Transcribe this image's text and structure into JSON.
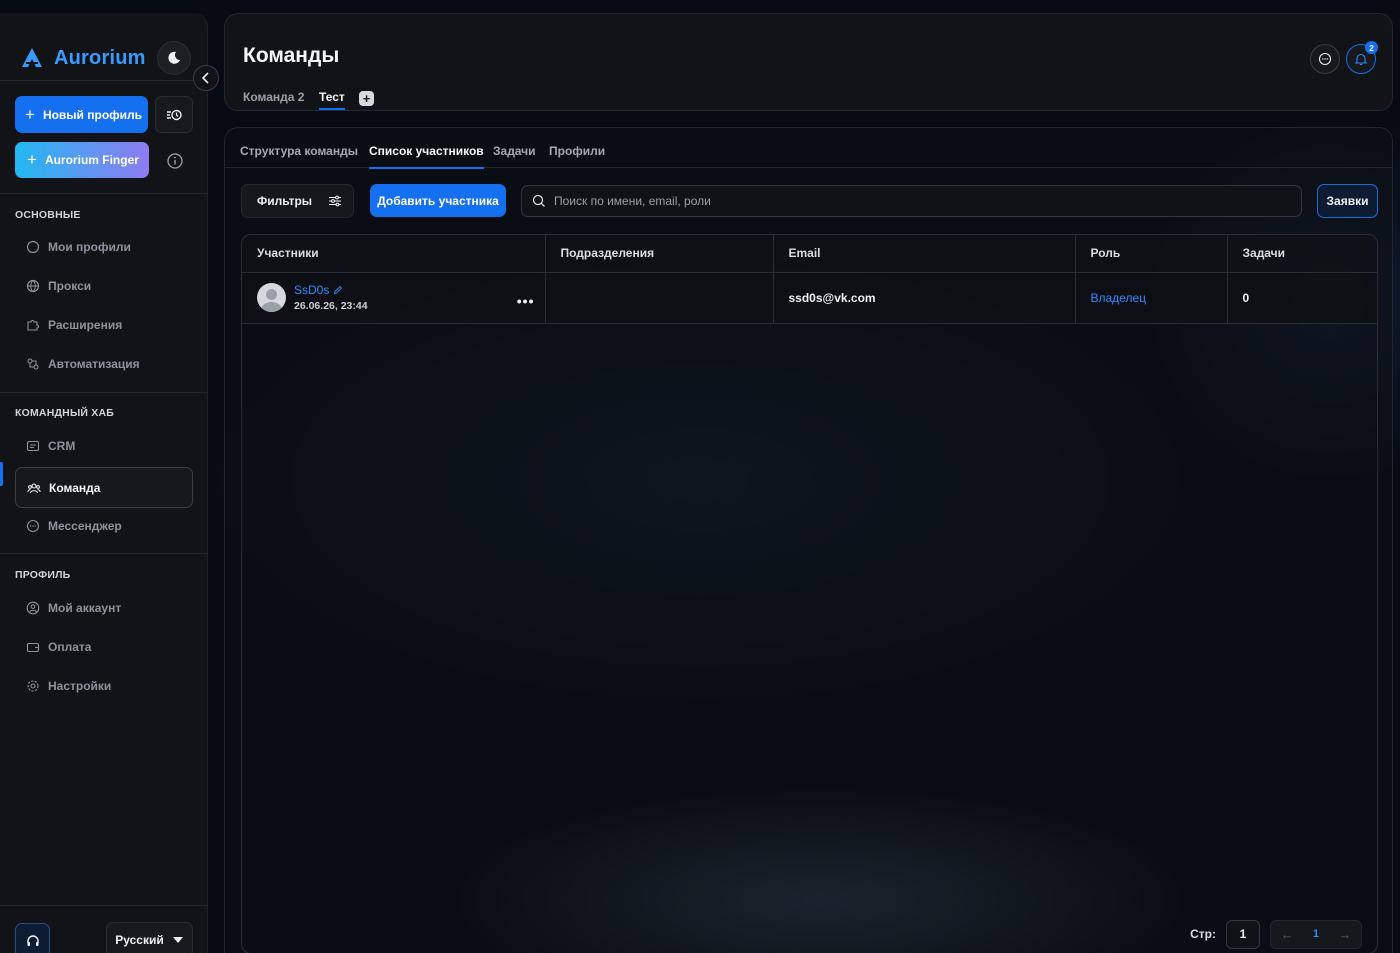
{
  "brand": {
    "name": "Aurorium"
  },
  "sidebar": {
    "new_profile_label": "Новый профиль",
    "finger_label": "Aurorium Finger",
    "sections": {
      "main": "ОСНОВНЫЕ",
      "team_hub": "КОМАНДНЫЙ ХАБ",
      "profile": "ПРОФИЛЬ"
    },
    "items": [
      {
        "label": "Мои профили",
        "icon": "browser-icon"
      },
      {
        "label": "Прокси",
        "icon": "globe-icon"
      },
      {
        "label": "Расширения",
        "icon": "puzzle-icon"
      },
      {
        "label": "Автоматизация",
        "icon": "automation-icon"
      },
      {
        "label": "CRM",
        "icon": "crm-icon"
      },
      {
        "label": "Команда",
        "icon": "team-icon",
        "active": true
      },
      {
        "label": "Мессенджер",
        "icon": "chat-icon"
      },
      {
        "label": "Мой аккаунт",
        "icon": "user-icon"
      },
      {
        "label": "Оплата",
        "icon": "wallet-icon"
      },
      {
        "label": "Настройки",
        "icon": "gear-icon"
      }
    ],
    "language": "Русский"
  },
  "header": {
    "title": "Команды",
    "team_tabs": [
      {
        "label": "Команда 2",
        "active": false
      },
      {
        "label": "Тест",
        "active": true
      }
    ],
    "add_team_symbol": "+",
    "notifications_count": "2"
  },
  "main": {
    "tabs": [
      {
        "label": "Структура команды",
        "active": false
      },
      {
        "label": "Список участников",
        "active": true
      },
      {
        "label": "Задачи",
        "active": false
      },
      {
        "label": "Профили",
        "active": false
      }
    ],
    "filters_label": "Фильтры",
    "add_member_label": "Добавить участника",
    "search": {
      "placeholder": "Поиск по имени, email, роли",
      "value": ""
    },
    "requests_label": "Заявки",
    "table": {
      "columns": [
        "Участники",
        "Подразделения",
        "Email",
        "Роль",
        "Задачи"
      ],
      "rows": [
        {
          "name": "SsD0s",
          "date": "26.06.26, 23:44",
          "department": "",
          "email": "ssd0s@vk.com",
          "role": "Владелец",
          "tasks": "0"
        }
      ]
    },
    "pagination": {
      "label": "Стр:",
      "page_input": "1",
      "current": "1"
    }
  },
  "colors": {
    "accent": "#1570ef",
    "link": "#2f8bff",
    "sidebar_bg": "#121316"
  }
}
